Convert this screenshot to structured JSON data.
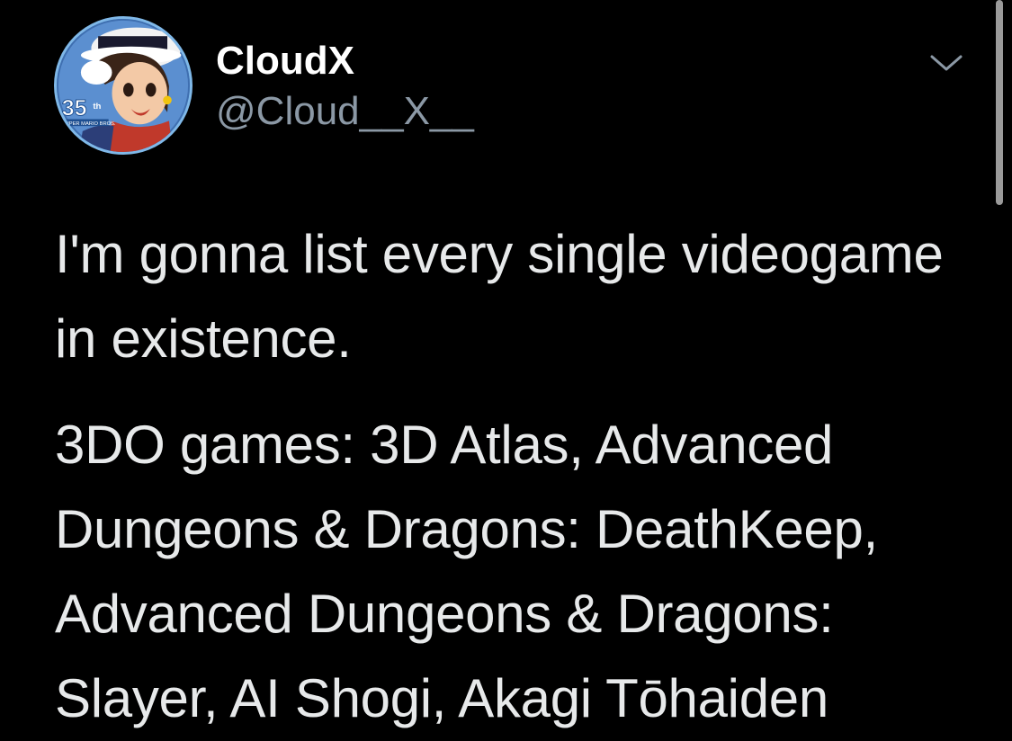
{
  "author": {
    "display_name": "CloudX",
    "handle": "@Cloud__X__",
    "avatar_badge": "35th",
    "avatar_caption": "SUPER MARIO BROS."
  },
  "tweet": {
    "paragraphs": [
      "I'm gonna list every single videogame in existence.",
      "3DO games: 3D Atlas, Advanced Dungeons & Dragons: DeathKeep, Advanced Dungeons & Dragons: Slayer, AI Shogi, Akagi Tōhaiden"
    ]
  },
  "icons": {
    "more": "chevron-down-icon",
    "avatar_badge": "anniversary-badge-icon"
  },
  "colors": {
    "background": "#000000",
    "display_name": "#ffffff",
    "handle": "#8b98a5",
    "body_text": "#e7e9ea",
    "avatar_border": "#7fb8e8"
  }
}
